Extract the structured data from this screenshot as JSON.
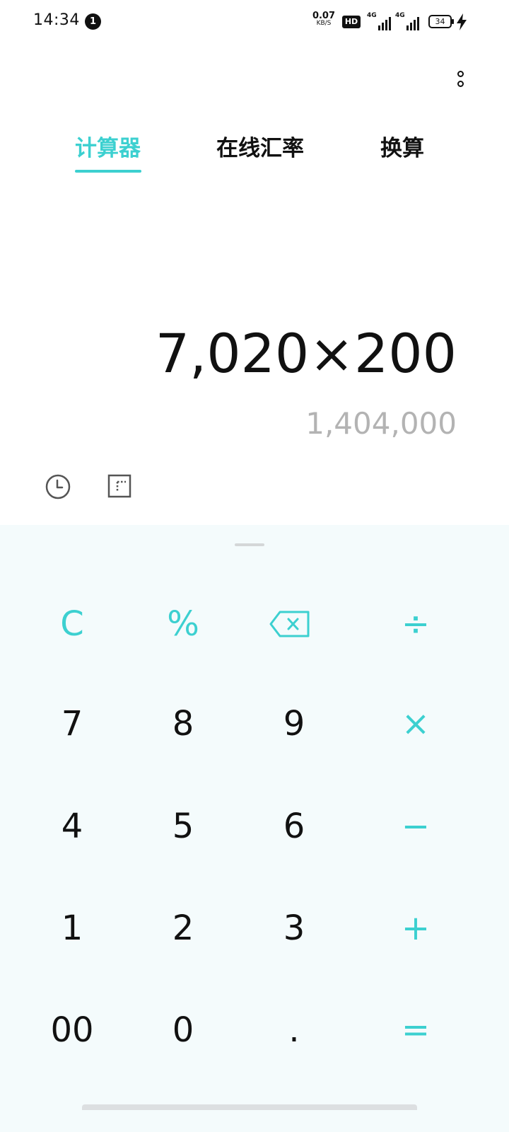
{
  "status_bar": {
    "time": "14:34",
    "notification_count": "1",
    "net_speed_value": "0.07",
    "net_speed_unit": "KB/S",
    "hd_label": "HD",
    "sim1_type": "4G",
    "sim2_type": "4G",
    "battery_level": "34"
  },
  "tabs": [
    {
      "label": "计算器",
      "active": true
    },
    {
      "label": "在线汇率",
      "active": false
    },
    {
      "label": "换算",
      "active": false
    }
  ],
  "display": {
    "expression": "7,020×200",
    "result": "1,404,000"
  },
  "keypad": {
    "rows": [
      [
        "C",
        "%",
        "",
        "÷"
      ],
      [
        "7",
        "8",
        "9",
        "×"
      ],
      [
        "4",
        "5",
        "6",
        "−"
      ],
      [
        "1",
        "2",
        "3",
        "+"
      ],
      [
        "00",
        "0",
        ".",
        "="
      ]
    ]
  },
  "icons": {
    "history": "clock-icon",
    "scientific": "scientific-mode-icon",
    "backspace": "backspace-icon",
    "more": "more-vertical-icon"
  },
  "colors": {
    "accent": "#3cd0d0",
    "keypad_background": "#f4fbfc",
    "result_text": "#b3b3b3"
  }
}
